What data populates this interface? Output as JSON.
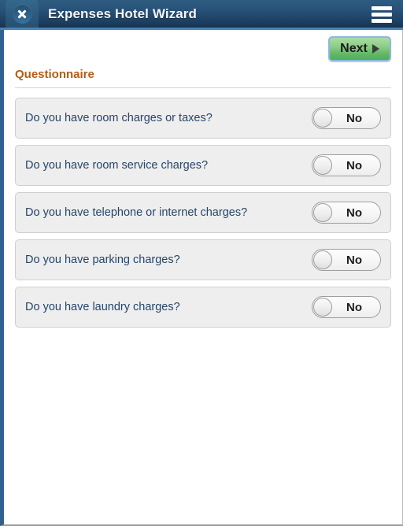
{
  "header": {
    "title": "Expenses Hotel Wizard",
    "close_icon": "close-x-icon",
    "menu_icon": "hamburger-menu-icon"
  },
  "toolbar": {
    "next_label": "Next",
    "next_arrow_icon": "arrow-right-icon"
  },
  "section": {
    "title": "Questionnaire"
  },
  "questions": [
    {
      "text": "Do you have room charges or taxes?",
      "value": "No"
    },
    {
      "text": "Do you have room service charges?",
      "value": "No"
    },
    {
      "text": "Do you have telephone or internet charges?",
      "value": "No"
    },
    {
      "text": "Do you have parking charges?",
      "value": "No"
    },
    {
      "text": "Do you have laundry charges?",
      "value": "No"
    }
  ],
  "colors": {
    "header_blue": "#28527a",
    "header_accent": "#4b82b4",
    "left_rail_blue": "#2f6293",
    "section_title": "#b35c15",
    "question_text": "#25456b",
    "next_button_green": "#61b765",
    "next_button_border": "#8fb8e0",
    "row_background": "#eeeeee"
  }
}
